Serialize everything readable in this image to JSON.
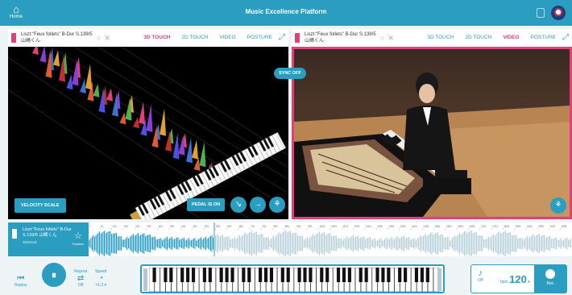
{
  "app": {
    "title": "Music Excellence Platform",
    "home_label": "Home"
  },
  "left_panel": {
    "piece_title": "Liszt:\"Feux follets\" B-Dur S.139/5",
    "performer": "山崎くん",
    "tabs": [
      "3D TOUCH",
      "2D TOUCH",
      "VIDEO",
      "POSTURE"
    ],
    "active_tab": "3D TOUCH",
    "velocity_button": "VELOCITY SCALE",
    "pedal_button": "PEDAL IS ON"
  },
  "right_panel": {
    "piece_title": "Liszt:\"Feux follets\" B-Dur S.139/5",
    "performer": "山崎くん",
    "tabs": [
      "3D TOUCH",
      "2D TOUCH",
      "VIDEO",
      "POSTURE"
    ],
    "active_tab": "VIDEO"
  },
  "sync_button": "SYNC OFF",
  "timeline": {
    "piece_title": "Liszt:\"Feux follets\" B-Dur S.139/5 山崎くん",
    "selected_label": "Selected",
    "reaction_label": "Reaction",
    "ticks": [
      "1",
      "51",
      "101",
      "151",
      "201",
      "251",
      "301",
      "351",
      "401",
      "451",
      "501",
      "551",
      "601",
      "651",
      "701",
      "751",
      "801",
      "851",
      "901",
      "951",
      "1001",
      "1051",
      "1101",
      "1151",
      "1201",
      "1251",
      "1301",
      "1351",
      "1401",
      "1451",
      "1501",
      "1551",
      "1601",
      "1651",
      "1701",
      "1751",
      "1801",
      "1851",
      "1901",
      "1951",
      "2001",
      "2051"
    ],
    "progress": 0.26
  },
  "controls": {
    "replay_label": "Replay",
    "repeat_label": "Repeat",
    "repeat_state": "Off",
    "speed_label": "Speed",
    "speed_value": "×1.0 ▾",
    "metronome_state": "Off",
    "tempo_prefix": "bpm",
    "tempo_value": "120",
    "rec_label": "Rec"
  },
  "colors": {
    "accent": "#2a9dc0",
    "highlight": "#e0417a"
  }
}
